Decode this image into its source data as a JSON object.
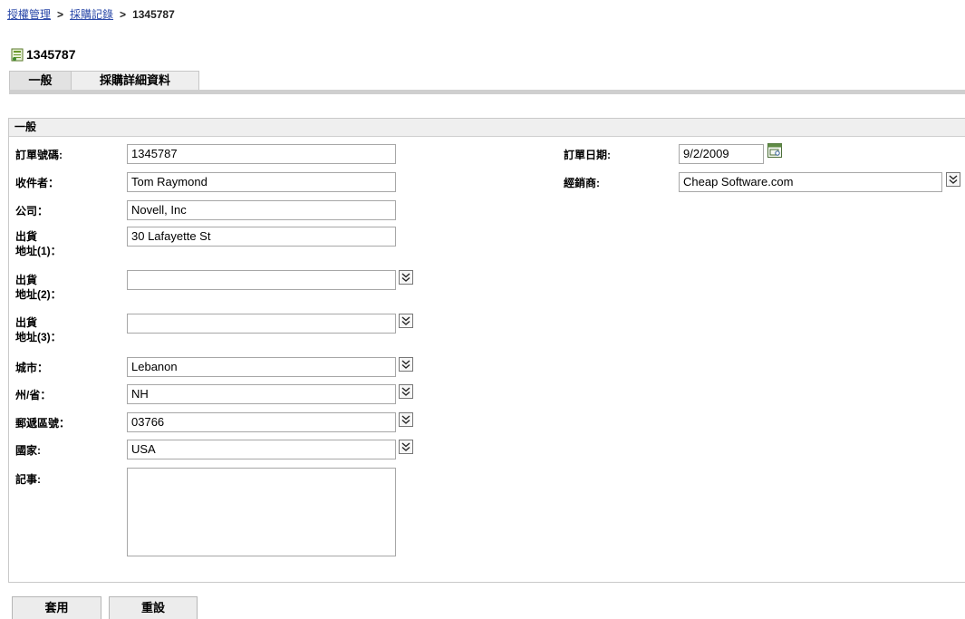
{
  "breadcrumb": {
    "items": [
      "授權管理",
      "採購記錄"
    ],
    "separator": ">",
    "current": "1345787"
  },
  "title": {
    "text": "1345787",
    "icon": "order-document-icon"
  },
  "tabs": [
    {
      "label": "一般",
      "active": true
    },
    {
      "label": "採購詳細資料",
      "active": false
    }
  ],
  "section": {
    "header": "一般"
  },
  "fields": {
    "order_number": {
      "label": "訂單號碼:",
      "value": "1345787"
    },
    "recipient": {
      "label": "收件者：",
      "value": "Tom Raymond"
    },
    "company": {
      "label": "公司：",
      "value": "Novell, Inc"
    },
    "ship_addr1": {
      "label_line1": "出貨",
      "label_line2": "地址(1)：",
      "value": "30 Lafayette St"
    },
    "ship_addr2": {
      "label_line1": "出貨",
      "label_line2": "地址(2)：",
      "value": ""
    },
    "ship_addr3": {
      "label_line1": "出貨",
      "label_line2": "地址(3)：",
      "value": ""
    },
    "city": {
      "label": "城市：",
      "value": "Lebanon"
    },
    "state": {
      "label": "州/省：",
      "value": "NH"
    },
    "postal": {
      "label": "郵遞區號：",
      "value": "03766"
    },
    "country": {
      "label": "國家:",
      "value": "USA"
    },
    "notes": {
      "label": "記事:",
      "value": ""
    },
    "order_date": {
      "label": "訂單日期:",
      "value": "9/2/2009"
    },
    "reseller": {
      "label": "經銷商:",
      "value": "Cheap Software.com"
    }
  },
  "buttons": {
    "apply": "套用",
    "reset": "重設"
  },
  "colors": {
    "link": "#2a48a8",
    "tab_bar": "#cfcfcf",
    "panel_header": "#efefef",
    "border": "#a7a7a7"
  }
}
